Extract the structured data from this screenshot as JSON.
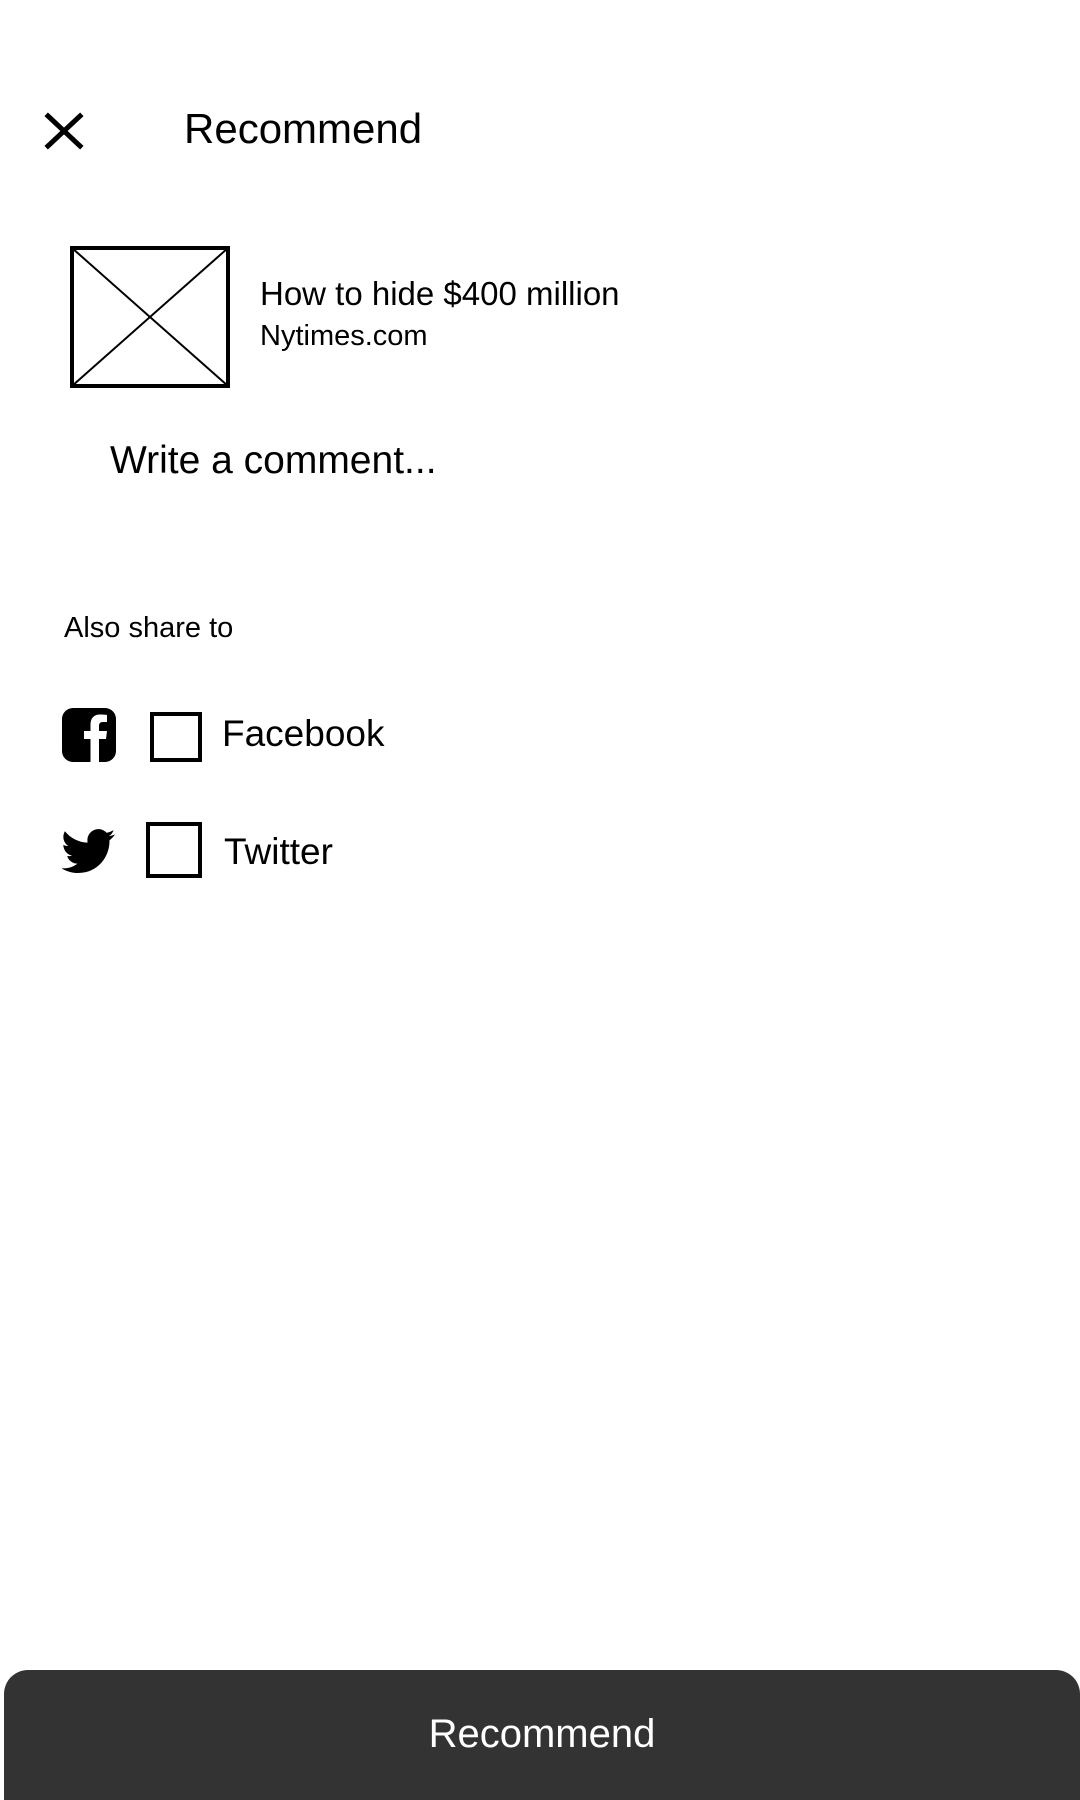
{
  "header": {
    "close_icon": "close-icon",
    "title": "Recommend"
  },
  "article": {
    "thumbnail_icon": "image-placeholder-icon",
    "title": "How to hide $400 million",
    "source": "Nytimes.com"
  },
  "comment": {
    "placeholder": "Write a comment...",
    "value": ""
  },
  "share": {
    "label": "Also share to",
    "options": [
      {
        "icon": "facebook-icon",
        "label": "Facebook",
        "checked": false
      },
      {
        "icon": "twitter-icon",
        "label": "Twitter",
        "checked": false
      }
    ]
  },
  "action": {
    "label": "Recommend",
    "background": "#333333",
    "text_color": "#ffffff"
  }
}
